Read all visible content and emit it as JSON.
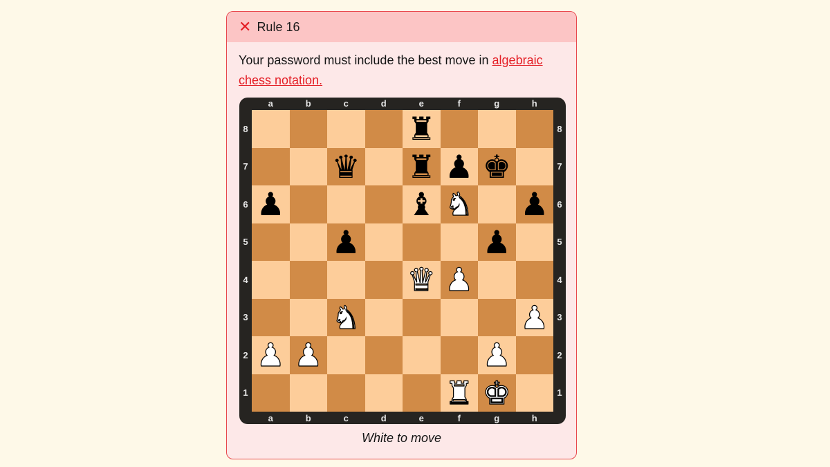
{
  "rule": {
    "status": "failed",
    "status_icon": "x-icon",
    "title": "Rule 16",
    "description_prefix": "Your password must include the best move in ",
    "link_text": "algebraic chess notation.",
    "caption": "White to move"
  },
  "colors": {
    "accent_red": "#e41f26",
    "header_bg": "#fcc5c5",
    "card_bg": "#fde8e8",
    "light_square": "#fdcd9a",
    "dark_square": "#d18b47",
    "frame": "#262421"
  },
  "board": {
    "files": [
      "a",
      "b",
      "c",
      "d",
      "e",
      "f",
      "g",
      "h"
    ],
    "ranks": [
      "8",
      "7",
      "6",
      "5",
      "4",
      "3",
      "2",
      "1"
    ],
    "side_to_move": "white",
    "pieces": [
      {
        "square": "e8",
        "color": "black",
        "type": "rook"
      },
      {
        "square": "c7",
        "color": "black",
        "type": "queen"
      },
      {
        "square": "e7",
        "color": "black",
        "type": "rook"
      },
      {
        "square": "f7",
        "color": "black",
        "type": "pawn"
      },
      {
        "square": "g7",
        "color": "black",
        "type": "king"
      },
      {
        "square": "a6",
        "color": "black",
        "type": "pawn"
      },
      {
        "square": "e6",
        "color": "black",
        "type": "bishop"
      },
      {
        "square": "f6",
        "color": "white",
        "type": "knight"
      },
      {
        "square": "h6",
        "color": "black",
        "type": "pawn"
      },
      {
        "square": "c5",
        "color": "black",
        "type": "pawn"
      },
      {
        "square": "g5",
        "color": "black",
        "type": "pawn"
      },
      {
        "square": "e4",
        "color": "white",
        "type": "queen"
      },
      {
        "square": "f4",
        "color": "white",
        "type": "pawn"
      },
      {
        "square": "c3",
        "color": "white",
        "type": "knight"
      },
      {
        "square": "h3",
        "color": "white",
        "type": "pawn"
      },
      {
        "square": "a2",
        "color": "white",
        "type": "pawn"
      },
      {
        "square": "b2",
        "color": "white",
        "type": "pawn"
      },
      {
        "square": "g2",
        "color": "white",
        "type": "pawn"
      },
      {
        "square": "f1",
        "color": "white",
        "type": "rook"
      },
      {
        "square": "g1",
        "color": "white",
        "type": "king"
      }
    ]
  }
}
